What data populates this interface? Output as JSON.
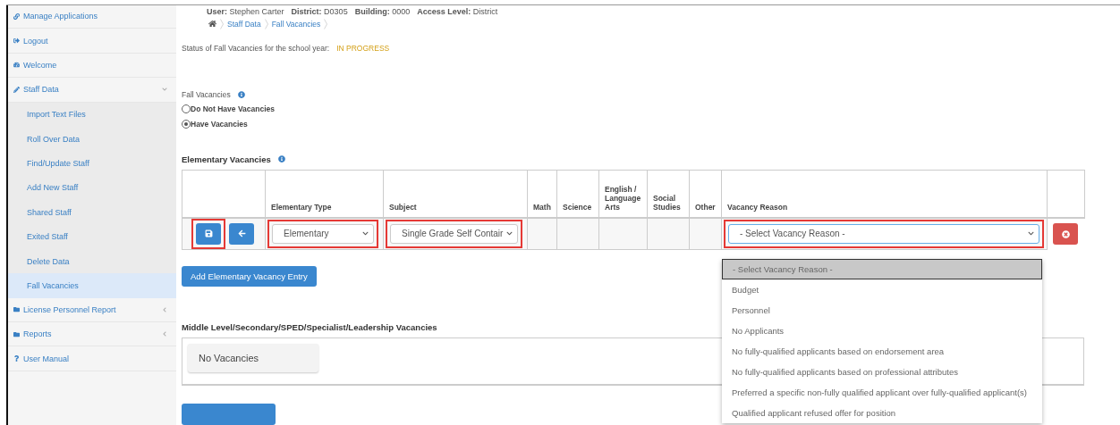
{
  "sidebar": {
    "items": [
      {
        "label": "Manage Applications",
        "kind": "link",
        "selected": false
      },
      {
        "label": "Logout",
        "kind": "link",
        "selected": false
      },
      {
        "label": "Welcome",
        "kind": "link",
        "selected": false
      },
      {
        "label": "Staff Data",
        "kind": "group",
        "expanded": true,
        "selected": false,
        "children": [
          {
            "label": "Import Text Files",
            "selected": false
          },
          {
            "label": "Roll Over Data",
            "selected": false
          },
          {
            "label": "Find/Update Staff",
            "selected": false
          },
          {
            "label": "Add New Staff",
            "selected": false
          },
          {
            "label": "Shared Staff",
            "selected": false
          },
          {
            "label": "Exited Staff",
            "selected": false
          },
          {
            "label": "Delete Data",
            "selected": false
          },
          {
            "label": "Fall Vacancies",
            "selected": true
          }
        ]
      },
      {
        "label": "License Personnel Report",
        "kind": "group",
        "expanded": false,
        "selected": false
      },
      {
        "label": "Reports",
        "kind": "group",
        "expanded": false,
        "selected": false
      },
      {
        "label": "User Manual",
        "kind": "help",
        "selected": false
      }
    ]
  },
  "user_bar": [
    {
      "label": "User:",
      "value": "Stephen Carter"
    },
    {
      "label": "District:",
      "value": "D0305"
    },
    {
      "label": "Building:",
      "value": "0000"
    },
    {
      "label": "Access Level:",
      "value": "District"
    }
  ],
  "breadcrumb": [
    "Staff Data",
    "Fall Vacancies"
  ],
  "status": {
    "label": "Status of Fall Vacancies for the school year:",
    "value": "IN PROGRESS"
  },
  "fall_vacancies": {
    "label": "Fall Vacancies",
    "options": [
      {
        "label": "Do Not Have Vacancies",
        "selected": false
      },
      {
        "label": "Have Vacancies",
        "selected": true
      }
    ]
  },
  "elementary": {
    "title": "Elementary Vacancies",
    "columns": [
      "Elementary Type",
      "Subject",
      "Math",
      "Science",
      "English / Language Arts",
      "Social Studies",
      "Other",
      "Vacancy Reason"
    ],
    "rows": [
      {
        "elementary_type": "Elementary",
        "subject": "Single Grade Self Contair",
        "vacancy_reason": "- Select Vacancy Reason -",
        "highlighted": true
      }
    ],
    "add_button": "Add Elementary Vacancy Entry"
  },
  "reason_dropdown": {
    "open": true,
    "options": [
      {
        "label": "- Select Vacancy Reason -",
        "selected": true
      },
      {
        "label": "Budget",
        "selected": false
      },
      {
        "label": "Personnel",
        "selected": false
      },
      {
        "label": "No Applicants",
        "selected": false
      },
      {
        "label": "No fully-qualified applicants based on endorsement area",
        "selected": false
      },
      {
        "label": "No fully-qualified applicants based on professional attributes",
        "selected": false
      },
      {
        "label": "Preferred a specific non-fully qualified applicant over fully-qualified applicant(s)",
        "selected": false
      },
      {
        "label": "Qualified applicant refused offer for position",
        "selected": false
      }
    ]
  },
  "middle": {
    "title": "Middle Level/Secondary/SPED/Specialist/Leadership Vacancies",
    "empty_text": "No Vacancies"
  }
}
